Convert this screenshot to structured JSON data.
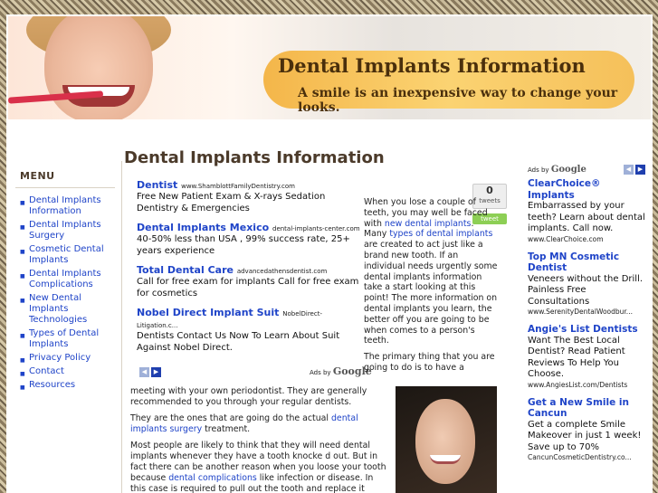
{
  "header": {
    "title": "Dental Implants Information",
    "tagline": "A smile is an inexpensive way to change your looks."
  },
  "sidebar": {
    "title": "MENU",
    "items": [
      {
        "label": "Dental Implants Information"
      },
      {
        "label": "Dental Implants Surgery"
      },
      {
        "label": "Cosmetic Dental Implants"
      },
      {
        "label": "Dental Implants Complications"
      },
      {
        "label": "New Dental Implants Technologies"
      },
      {
        "label": "Types of Dental Implants"
      },
      {
        "label": "Privacy Policy"
      },
      {
        "label": "Contact"
      },
      {
        "label": "Resources"
      }
    ]
  },
  "main": {
    "title": "Dental Implants Information",
    "ads": [
      {
        "headline": "Dentist",
        "url": "www.ShamblottFamilyDentistry.com",
        "text": "Free New Patient Exam & X-rays Sedation Dentistry & Emergencies"
      },
      {
        "headline": "Dental Implants Mexico",
        "url": "dental-implants-center.com",
        "text": "40-50% less than USA , 99% success rate, 25+ years experience"
      },
      {
        "headline": "Total Dental Care",
        "url": "advancedathensdentist.com",
        "text": "Call for free exam for implants Call for free exam for cosmetics"
      },
      {
        "headline": "Nobel Direct Implant Suit",
        "url": "NobelDirect-Litigation.c...",
        "text": "Dentists Contact Us Now To Learn About Suit Against Nobel Direct."
      }
    ],
    "ads_by": "Ads by",
    "ads_brand": "Google",
    "nav_prev": "◀",
    "nav_next": "▶",
    "tweet_count": "0",
    "tweet_label": "tweets",
    "tweet_button": "tweet",
    "intro_1": "When you lose a couple of teeth, you may well be faced with",
    "intro_link_1": "new dental implants",
    "intro_2": ". Many",
    "intro_link_2": "types of dental implants",
    "intro_3": " are created to act just like a brand new tooth. If an individual needs urgently some dental implants information take a start looking at this point! The more information on dental implants you learn, the better off you are going to be when comes to a person's teeth.",
    "intro_4": "The primary thing that you are going to do is to have a",
    "para_1": "meeting with your own periodontist. They are generally recommended to you through your regular dentists.",
    "para_2_a": "They are the ones that are going do the actual ",
    "para_2_link": "dental implants surgery",
    "para_2_b": " treatment.",
    "para_3_a": "Most people are likely to think that they will need dental implants whenever they have a tooth knocke d out. But in fact there can be another reason when you loose your tooth because ",
    "para_3_link": "dental complications",
    "para_3_b": " like infection or disease. In this case is required to pull out the tooth and replace it instead."
  },
  "rail": {
    "ads_by": "Ads by",
    "ads_brand": "Google",
    "nav_prev": "◀",
    "nav_next": "▶",
    "ads": [
      {
        "headline": "ClearChoice® Implants",
        "text": "Embarrassed by your teeth? Learn about dental implants. Call now.",
        "url": "www.ClearChoice.com"
      },
      {
        "headline": "Top MN Cosmetic Dentist",
        "text": "Veneers without the Drill. Painless Free Consultations",
        "url": "www.SerenityDentalWoodbur..."
      },
      {
        "headline": "Angie's List Dentists",
        "text": "Want The Best Local Dentist? Read Patient Reviews To Help You Choose.",
        "url": "www.AngiesList.com/Dentists"
      },
      {
        "headline": "Get a New Smile in Cancun",
        "text": "Get a complete Smile Makeover in just 1 week! Save up to 70%",
        "url": "CancunCosmeticDentistry.co..."
      }
    ]
  }
}
